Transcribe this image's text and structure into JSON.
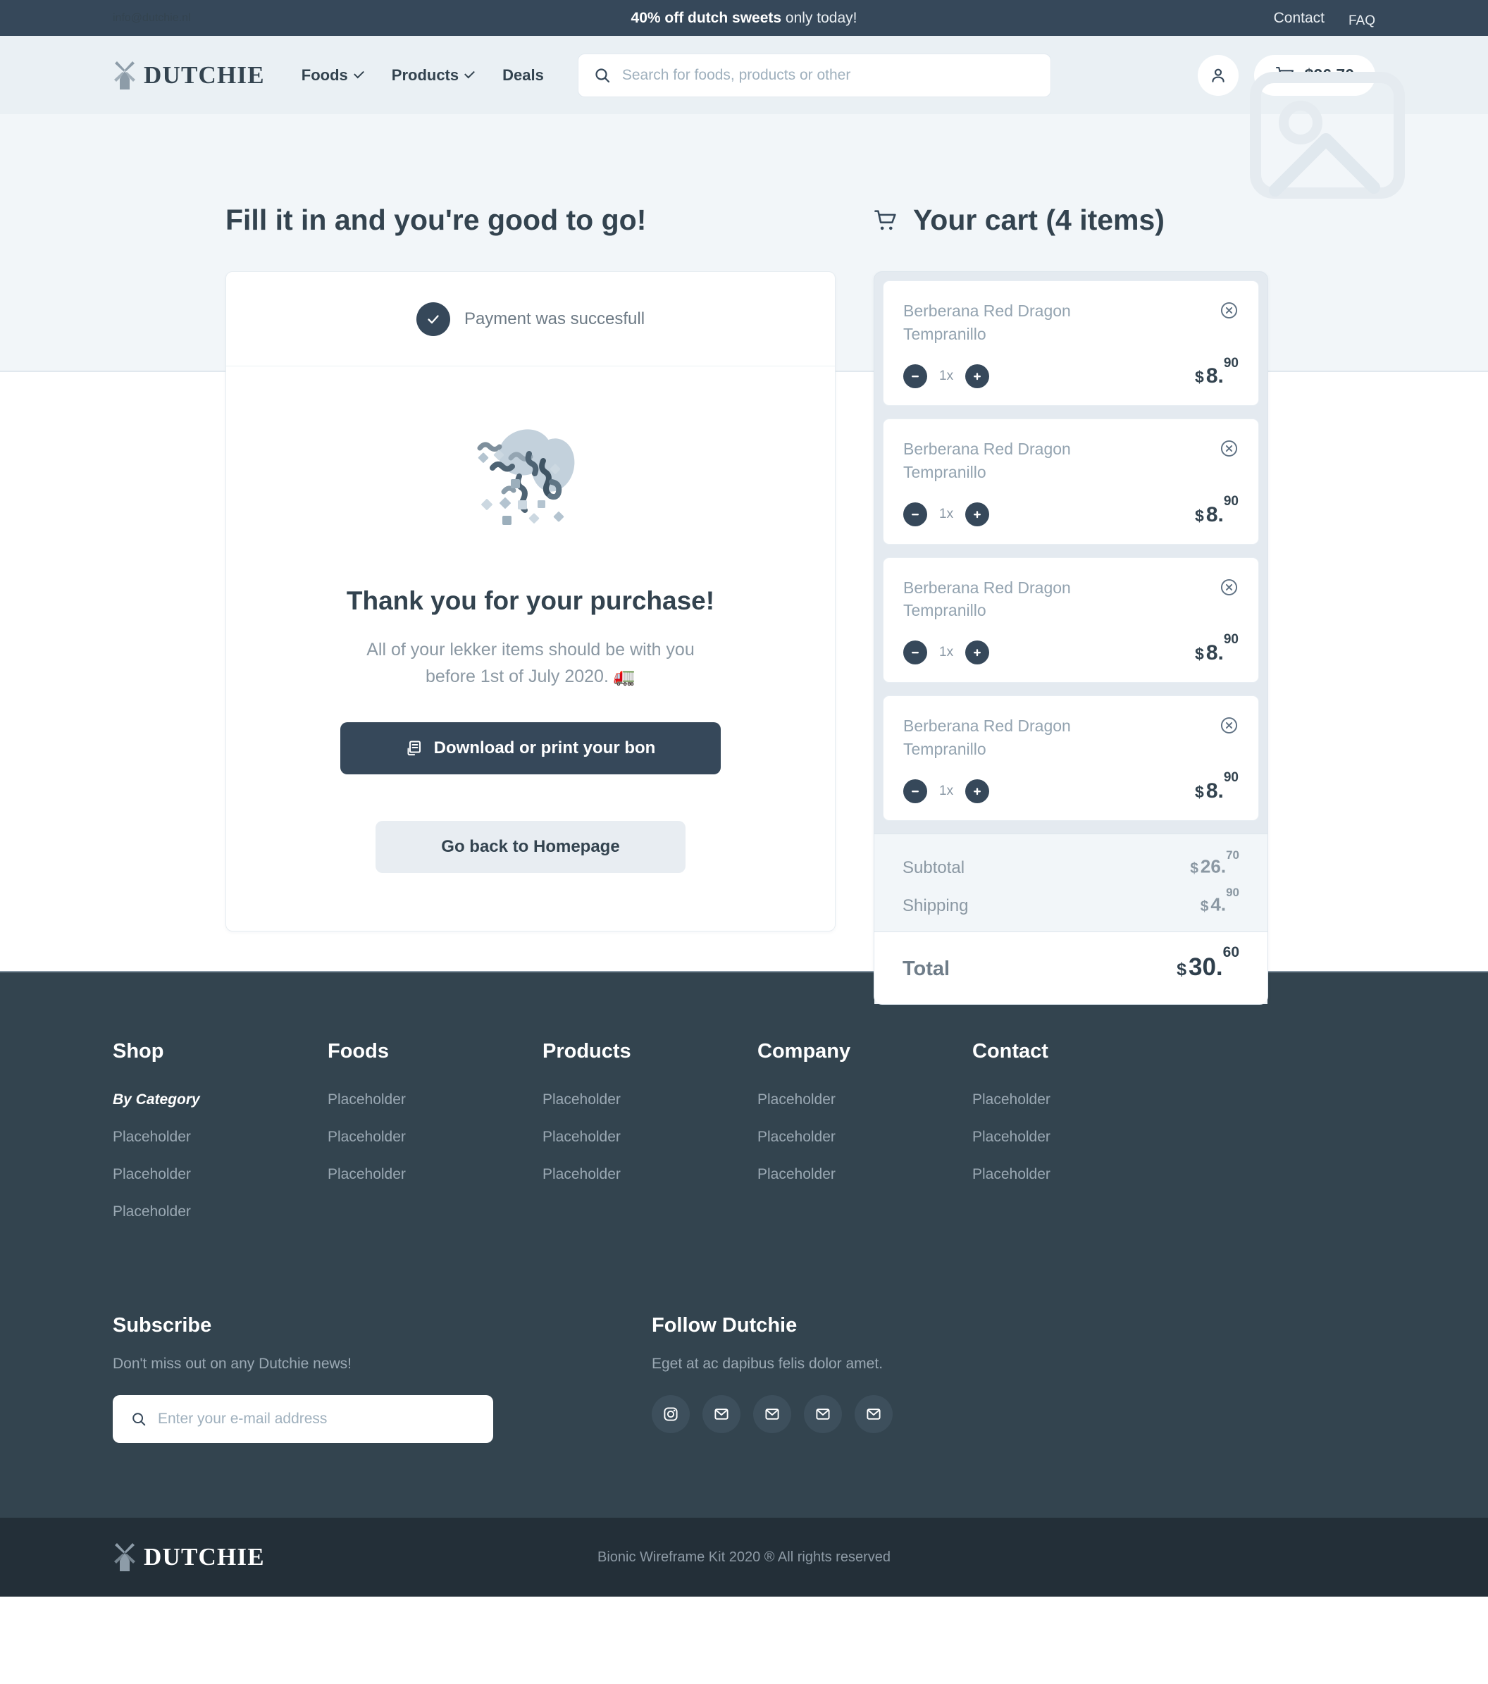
{
  "topbar": {
    "email": "info@dutchie.nl",
    "promo_bold": "40% off dutch sweets",
    "promo_rest": " only today!",
    "contact": "Contact",
    "faq": "FAQ"
  },
  "header": {
    "logo": "DUTCHIE",
    "nav": [
      {
        "label": "Foods",
        "caret": true
      },
      {
        "label": "Products",
        "caret": true
      },
      {
        "label": "Deals",
        "caret": false
      }
    ],
    "search_placeholder": "Search for foods, products or other",
    "search_value": "",
    "cart_amount": "$26.70"
  },
  "main": {
    "heading": "Fill it in and you're good to go!",
    "status": "Payment was succesfull",
    "thanks_title": "Thank you for your purchase!",
    "thanks_sub": "All of your lekker items should be with you before 1st of July 2020. 🚛",
    "primary_button": "Download or print your bon",
    "secondary_button": "Go back to Homepage"
  },
  "cart": {
    "title": "Your cart (4 items)",
    "items": [
      {
        "name": "Berberana Red Dragon Tempranillo",
        "qty": "1x",
        "currency": "$",
        "price_int": "8.",
        "price_cents": "90"
      },
      {
        "name": "Berberana Red Dragon Tempranillo",
        "qty": "1x",
        "currency": "$",
        "price_int": "8.",
        "price_cents": "90"
      },
      {
        "name": "Berberana Red Dragon Tempranillo",
        "qty": "1x",
        "currency": "$",
        "price_int": "8.",
        "price_cents": "90"
      },
      {
        "name": "Berberana Red Dragon Tempranillo",
        "qty": "1x",
        "currency": "$",
        "price_int": "8.",
        "price_cents": "90"
      }
    ],
    "subtotal_label": "Subtotal",
    "subtotal_cur": "$",
    "subtotal_int": "26.",
    "subtotal_cents": "70",
    "shipping_label": "Shipping",
    "shipping_cur": "$",
    "shipping_int": "4.",
    "shipping_cents": "90",
    "total_label": "Total",
    "total_cur": "$",
    "total_int": "30.",
    "total_cents": "60"
  },
  "footer": {
    "columns": [
      {
        "head": "Shop",
        "links": [
          "By Category",
          "Placeholder",
          "Placeholder",
          "Placeholder"
        ]
      },
      {
        "head": "Foods",
        "links": [
          "Placeholder",
          "Placeholder",
          "Placeholder"
        ]
      },
      {
        "head": "Products",
        "links": [
          "Placeholder",
          "Placeholder",
          "Placeholder"
        ]
      },
      {
        "head": "Company",
        "links": [
          "Placeholder",
          "Placeholder",
          "Placeholder"
        ]
      },
      {
        "head": "Contact",
        "links": [
          "Placeholder",
          "Placeholder",
          "Placeholder"
        ]
      }
    ],
    "subscribe_head": "Subscribe",
    "subscribe_desc": "Don't miss out on any Dutchie news!",
    "email_placeholder": "Enter your e-mail address",
    "email_value": "",
    "follow_head": "Follow Dutchie",
    "follow_desc": "Eget at ac dapibus felis dolor amet.",
    "socials": [
      "instagram-icon",
      "mail-icon",
      "mail-icon",
      "mail-icon",
      "mail-icon"
    ],
    "logo": "DUTCHIE",
    "copyright": "Bionic Wireframe Kit 2020 ® All rights reserved"
  },
  "colors": {
    "dark": "#36485a",
    "footer": "#33444f",
    "footer_bar": "#232f38",
    "hero": "#f2f6f9",
    "header": "#eaf0f4",
    "cart_panel": "#e4eaf0"
  }
}
